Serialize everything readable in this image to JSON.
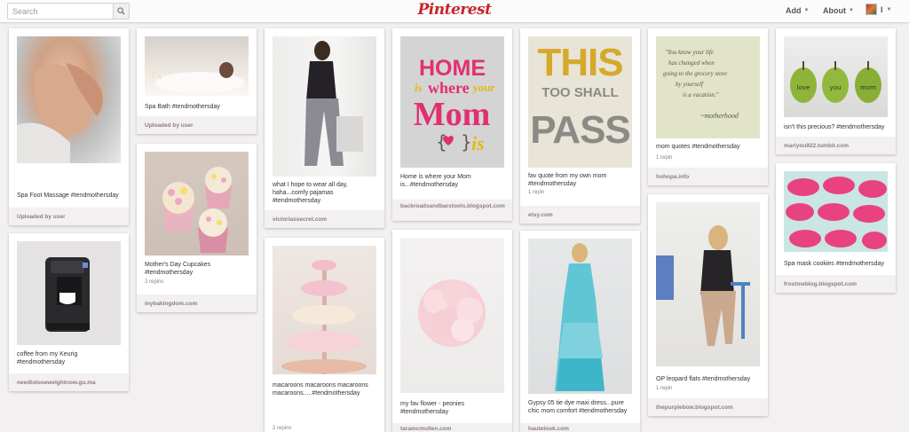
{
  "header": {
    "search_placeholder": "Search",
    "logo": "Pinterest",
    "nav": {
      "add": "Add",
      "about": "About",
      "user": "I"
    }
  },
  "pins": [
    {
      "id": "spa-foot",
      "desc": "Spa Foot Massage #tendmothersday",
      "repins": "",
      "source": "Uploaded by user"
    },
    {
      "id": "keurig",
      "desc": "coffee from my Keurig #tendmothersday",
      "repins": "",
      "source": "needtoloseweightnow.gu.ma"
    },
    {
      "id": "spa-bath",
      "desc": "Spa Bath #tendmothersday",
      "repins": "",
      "source": "Uploaded by user"
    },
    {
      "id": "cupcakes",
      "desc": "Mother's Day Cupcakes #tendmothersday",
      "repins": "2 repins",
      "source": "mybakingdom.com"
    },
    {
      "id": "pajamas",
      "desc": "what I hope to wear all day, haha...comfy pajamas #tendmothersday",
      "repins": "",
      "source": "victoriassecret.com"
    },
    {
      "id": "macaroons",
      "desc": "macaroons macaroons macaroons macaroons.....#tendmothersday",
      "repins": "2 repins",
      "source": ""
    },
    {
      "id": "home-mom",
      "desc": "Home is where your Mom is...#tendmothersday",
      "repins": "",
      "source": "backroadsandbarstools.blogspot.com"
    },
    {
      "id": "peonies",
      "desc": "my fav flower - peonies #tendmothersday",
      "repins": "",
      "source": "taramcmullen.com"
    },
    {
      "id": "this-too",
      "desc": "fav quote from my own mom #tendmothersday",
      "repins": "1 repin",
      "source": "etsy.com"
    },
    {
      "id": "gypsy",
      "desc": "Gypsy 05 tie dye maxi dress...pure chic mom comfort #tendmothersday",
      "repins": "",
      "source": "hautelook.com"
    },
    {
      "id": "mom-quotes",
      "desc": "mom quotes #tendmothersday",
      "repins": "1 repin",
      "source": "hohopa.info"
    },
    {
      "id": "flats",
      "desc": "OP leopard flats #tendmothersday",
      "repins": "1 repin",
      "source": "thepurplebow.blogspot.com"
    },
    {
      "id": "pears",
      "desc": "isn't this precious? #tendmothersday",
      "repins": "",
      "source": "mariyou922.tumblr.com"
    },
    {
      "id": "cookies",
      "desc": "Spa mask cookies #tendmothersday",
      "repins": "",
      "source": "frostmeblog.blogspot.com"
    }
  ],
  "image_text": {
    "home_line1": "HOME",
    "home_line2a": "is",
    "home_line2b": "where",
    "home_line2c": "your",
    "home_line3": "Mom",
    "home_line4": "is",
    "this_line1": "THIS",
    "this_line2": "TOO SHALL",
    "this_line3": "PASS",
    "quote_lines": [
      "\"You know your life",
      "has changed when",
      "going to the grocery store",
      "by yourself",
      "is a vacation.\""
    ],
    "quote_attr": "~motherhood",
    "pear_words": [
      "love",
      "you",
      "mom"
    ]
  },
  "colors": {
    "brand": "#c8232c",
    "source_bg": "#f2f0f0",
    "home_pink": "#e0306f",
    "home_yellow": "#e8b80f",
    "this_yellow": "#d6a92a",
    "pass_gray": "#8c8a86"
  }
}
